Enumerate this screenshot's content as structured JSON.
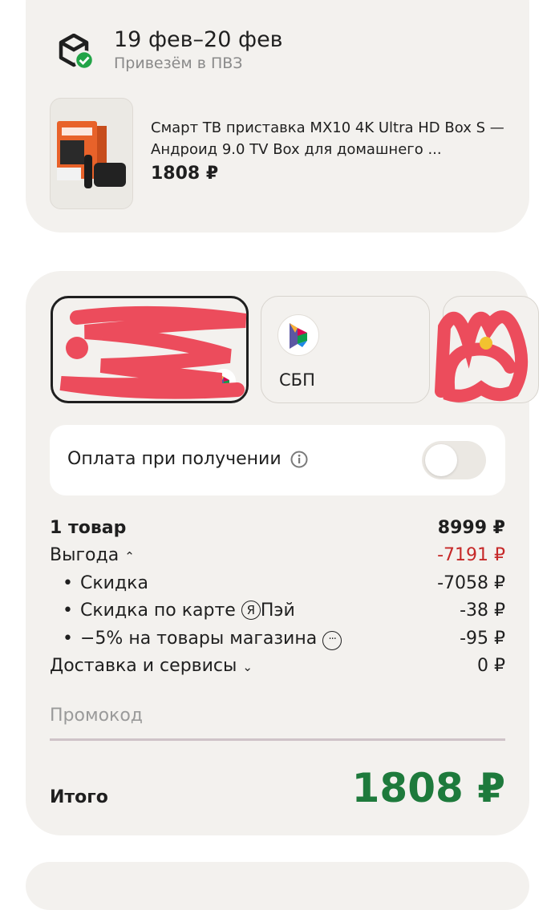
{
  "delivery": {
    "date": "19 фев–20 фев",
    "subtitle": "Привезём в ПВЗ",
    "product_title": "Смарт ТВ приставка MX10 4K Ultra HD Box S — Андроид 9.0 TV Box для домашнего ...",
    "product_price": "1808 ₽",
    "box_icon": "package-check-icon"
  },
  "payment": {
    "methods": [
      {
        "label": "",
        "icon": "bank-card"
      },
      {
        "label": "СБП",
        "icon": "sbp-logo"
      },
      {
        "label": "",
        "icon": "payment-method"
      }
    ],
    "cash_on_delivery": {
      "label": "Оплата при получении",
      "enabled": false
    }
  },
  "summary": {
    "items_label": "1 товар",
    "items_value": "8999 ₽",
    "benefit_label": "Выгода",
    "benefit_value": "-7191 ₽",
    "discount_label": "Скидка",
    "discount_value": "-7058 ₽",
    "card_discount_label": "Скидка по карте",
    "card_discount_brand": "Пэй",
    "card_discount_value": "-38 ₽",
    "shop_discount_label": "−5% на товары магазина",
    "shop_discount_value": "-95 ₽",
    "delivery_label": "Доставка и сервисы",
    "delivery_value": "0 ₽",
    "bullet": "•",
    "chevron_up": "⌃",
    "chevron_down": "⌄",
    "ya_glyph": "Я",
    "dots_glyph": "···"
  },
  "promo": {
    "placeholder": "Промокод"
  },
  "total": {
    "label": "Итого",
    "value": "1808 ₽"
  },
  "colors": {
    "total_green": "#1e7a3c",
    "benefit_red": "#c62828",
    "card_bg": "#f3f1ee"
  }
}
